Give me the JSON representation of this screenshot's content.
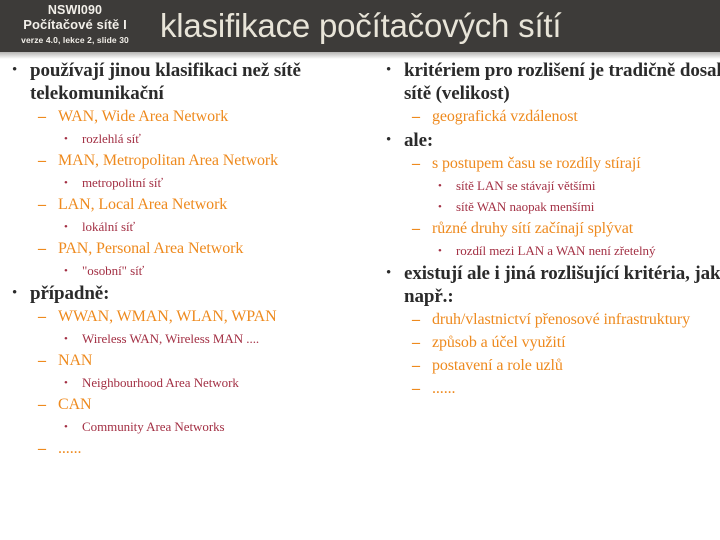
{
  "header": {
    "course_code": "NSWI090",
    "course_name": "Počítačové sítě I",
    "version_line": "verze 4.0, lekce  2, slide 30",
    "title": "klasifikace počítačových sítí",
    "bar_color": "#3d3b39",
    "title_color": "#e8e4d8"
  },
  "colors": {
    "level1": "#2b2b2b",
    "level2": "#ee8a1e",
    "level3": "#a33044",
    "background": "#ffffff"
  },
  "markers": {
    "level1": "•",
    "level2": "–",
    "level3": "•"
  },
  "left_column": [
    {
      "level": 1,
      "text": "používají jinou klasifikaci než sítě telekomunikační"
    },
    {
      "level": 2,
      "text": "WAN, Wide Area Network"
    },
    {
      "level": 3,
      "text": "rozlehlá síť"
    },
    {
      "level": 2,
      "text": "MAN, Metropolitan Area Network"
    },
    {
      "level": 3,
      "text": "metropolitní síť"
    },
    {
      "level": 2,
      "text": "LAN, Local Area Network"
    },
    {
      "level": 3,
      "text": "lokální síť"
    },
    {
      "level": 2,
      "text": "PAN, Personal Area Network"
    },
    {
      "level": 3,
      "text": "\"osobní\" síť"
    },
    {
      "level": 1,
      "text": "případně:"
    },
    {
      "level": 2,
      "text": "WWAN, WMAN, WLAN, WPAN"
    },
    {
      "level": 3,
      "text": "Wireless WAN, Wireless MAN ...."
    },
    {
      "level": 2,
      "text": "NAN"
    },
    {
      "level": 3,
      "text": "Neighbourhood Area Network"
    },
    {
      "level": 2,
      "text": "CAN"
    },
    {
      "level": 3,
      "text": "Community  Area Networks"
    },
    {
      "level": 2,
      "text": "......"
    }
  ],
  "right_column": [
    {
      "level": 1,
      "text": "kritériem pro rozlišení je tradičně dosah sítě (velikost)"
    },
    {
      "level": 2,
      "text": "geografická vzdálenost"
    },
    {
      "level": 1,
      "text": "ale:"
    },
    {
      "level": 2,
      "text": "s postupem času se rozdíly stírají"
    },
    {
      "level": 3,
      "text": "sítě  LAN se stávají většími"
    },
    {
      "level": 3,
      "text": "sítě WAN naopak menšími"
    },
    {
      "level": 2,
      "text": "různé druhy sítí začínají splývat"
    },
    {
      "level": 3,
      "text": "rozdíl mezi  LAN a WAN není zřetelný"
    },
    {
      "level": 1,
      "text": "existují ale i jiná rozlišující kritéria, jako např.:"
    },
    {
      "level": 2,
      "text": "druh/vlastnictví přenosové infrastruktury"
    },
    {
      "level": 2,
      "text": "způsob a účel využití"
    },
    {
      "level": 2,
      "text": "postavení a role uzlů"
    },
    {
      "level": 2,
      "text": "......"
    }
  ]
}
